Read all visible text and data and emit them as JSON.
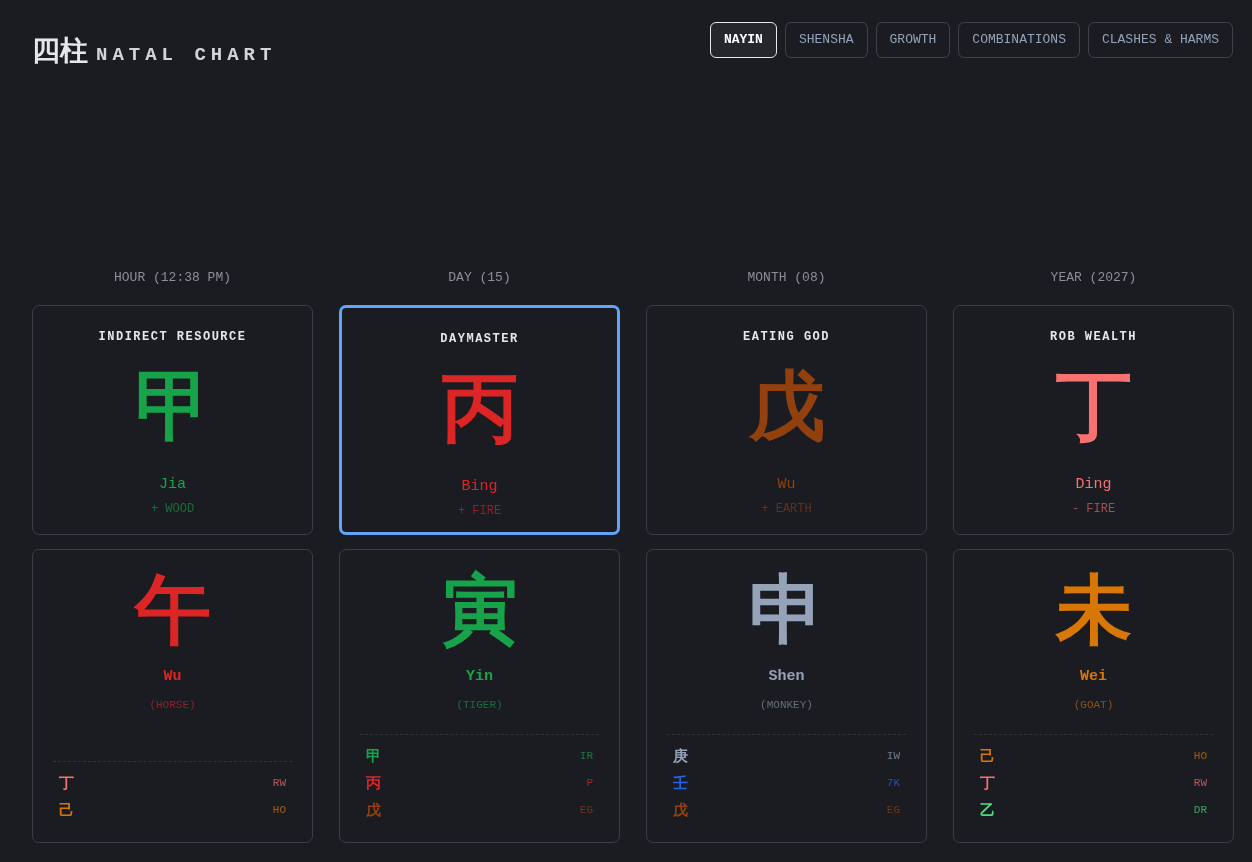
{
  "header": {
    "glyphs": "四柱",
    "title": "NATAL CHART"
  },
  "tabs": [
    {
      "label": "NAYIN",
      "selected": true
    },
    {
      "label": "SHENSHA",
      "selected": false
    },
    {
      "label": "GROWTH",
      "selected": false
    },
    {
      "label": "COMBINATIONS",
      "selected": false
    },
    {
      "label": "CLASHES & HARMS",
      "selected": false
    }
  ],
  "pillars": [
    {
      "heading": "HOUR (12:38 PM)",
      "stem": {
        "role": "INDIRECT RESOURCE",
        "char": "甲",
        "name": "Jia",
        "element": "+ WOOD",
        "color": "#16a34a",
        "highlighted": false
      },
      "branch": {
        "char": "午",
        "name": "Wu",
        "animal": "(HORSE)",
        "color": "#dc2626",
        "hidden": [
          {
            "char": "丁",
            "code": "RW",
            "color": "#f87171"
          },
          {
            "char": "己",
            "code": "HO",
            "color": "#d97706"
          }
        ]
      }
    },
    {
      "heading": "DAY (15)",
      "stem": {
        "role": "DAYMASTER",
        "char": "丙",
        "name": "Bing",
        "element": "+ FIRE",
        "color": "#dc2626",
        "highlighted": true
      },
      "branch": {
        "char": "寅",
        "name": "Yin",
        "animal": "(TIGER)",
        "color": "#16a34a",
        "hidden": [
          {
            "char": "甲",
            "code": "IR",
            "color": "#16a34a"
          },
          {
            "char": "丙",
            "code": "P",
            "color": "#dc2626"
          },
          {
            "char": "戊",
            "code": "EG",
            "color": "#92400e"
          }
        ]
      }
    },
    {
      "heading": "MONTH (08)",
      "stem": {
        "role": "EATING GOD",
        "char": "戊",
        "name": "Wu",
        "element": "+ EARTH",
        "color": "#92400e",
        "highlighted": false
      },
      "branch": {
        "char": "申",
        "name": "Shen",
        "animal": "(MONKEY)",
        "color": "#94a3b8",
        "hidden": [
          {
            "char": "庚",
            "code": "IW",
            "color": "#94a3b8"
          },
          {
            "char": "壬",
            "code": "7K",
            "color": "#2563eb"
          },
          {
            "char": "戊",
            "code": "EG",
            "color": "#92400e"
          }
        ]
      }
    },
    {
      "heading": "YEAR (2027)",
      "stem": {
        "role": "ROB WEALTH",
        "char": "丁",
        "name": "Ding",
        "element": "- FIRE",
        "color": "#f87171",
        "highlighted": false
      },
      "branch": {
        "char": "未",
        "name": "Wei",
        "animal": "(GOAT)",
        "color": "#d97706",
        "hidden": [
          {
            "char": "己",
            "code": "HO",
            "color": "#d97706"
          },
          {
            "char": "丁",
            "code": "RW",
            "color": "#f87171"
          },
          {
            "char": "乙",
            "code": "DR",
            "color": "#4ade80"
          }
        ]
      }
    }
  ]
}
